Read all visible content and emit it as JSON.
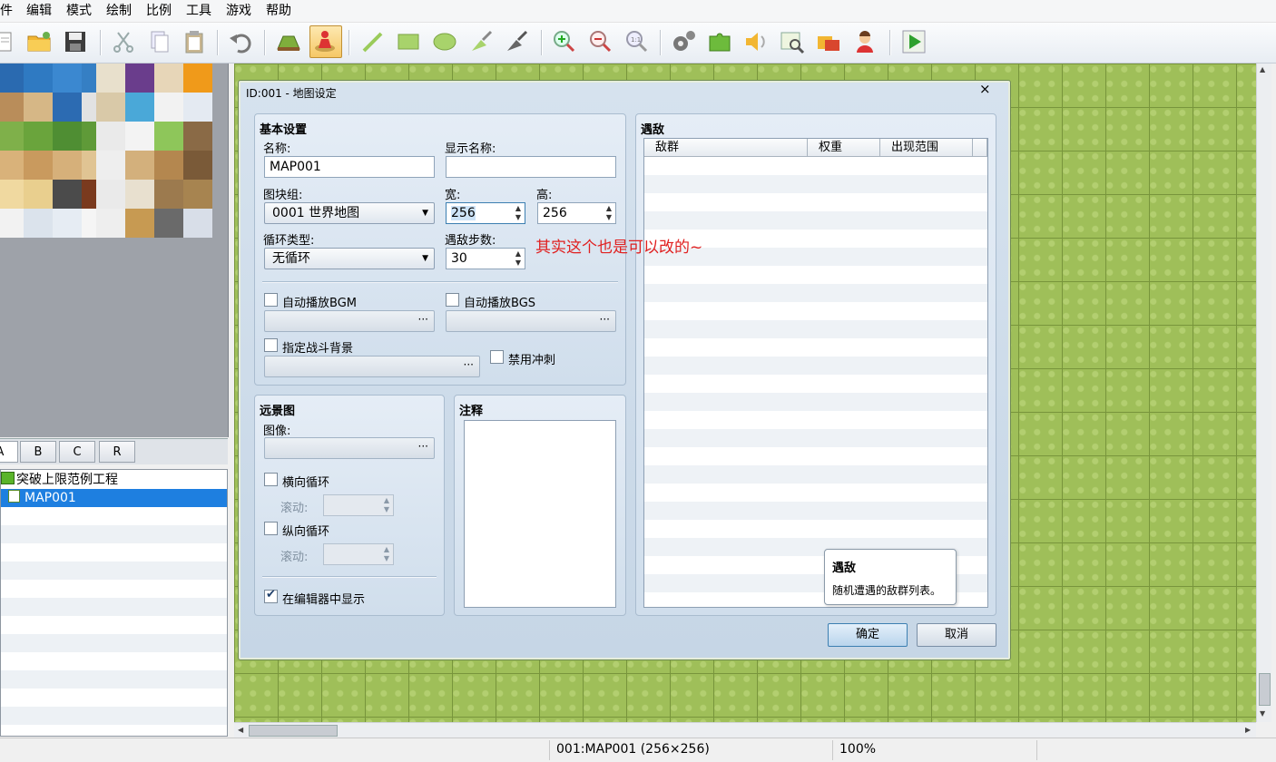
{
  "menu": [
    "件",
    "编辑",
    "模式",
    "绘制",
    "比例",
    "工具",
    "游戏",
    "帮助"
  ],
  "tileset_tabs": [
    "A",
    "B",
    "C",
    "R"
  ],
  "tree": {
    "project": "突破上限范例工程",
    "map": "MAP001"
  },
  "status": {
    "map": "001:MAP001 (256×256)",
    "zoom": "100%"
  },
  "dialog": {
    "title": "ID:001 - 地图设定",
    "close": "×",
    "basic": {
      "title": "基本设置",
      "name_label": "名称:",
      "name_value": "MAP001",
      "display_label": "显示名称:",
      "display_value": "",
      "tileset_label": "图块组:",
      "tileset_value": "0001 世界地图",
      "width_label": "宽:",
      "width_value": "256",
      "height_label": "高:",
      "height_value": "256",
      "loop_label": "循环类型:",
      "loop_value": "无循环",
      "steps_label": "遇敌步数:",
      "steps_value": "30",
      "bgm_label": "自动播放BGM",
      "bgs_label": "自动播放BGS",
      "battleback_label": "指定战斗背景",
      "dash_label": "禁用冲刺",
      "browse": "···"
    },
    "parallax": {
      "title": "远景图",
      "image_label": "图像:",
      "hloop_label": "横向循环",
      "vloop_label": "纵向循环",
      "scroll_label": "滚动:",
      "show_label": "在编辑器中显示",
      "browse": "···"
    },
    "note": {
      "title": "注释"
    },
    "encounters": {
      "title": "遇敌",
      "columns": [
        "敌群",
        "权重",
        "出现范围"
      ]
    },
    "tooltip": {
      "title": "遇敌",
      "text": "随机遭遇的敌群列表。"
    },
    "ok": "确定",
    "cancel": "取消"
  },
  "annotation": "其实这个也是可以改的~",
  "icons": [
    "new-icon",
    "open-icon",
    "save-icon",
    "cut-icon",
    "copy-icon",
    "paste-icon",
    "undo-icon",
    "map-mode-icon",
    "event-mode-icon",
    "pencil-icon",
    "rectangle-icon",
    "ellipse-icon",
    "fill-icon",
    "shadow-pen-icon",
    "zoom-in-icon",
    "zoom-out-icon",
    "zoom-actual-icon",
    "database-icon",
    "plugin-icon",
    "sound-icon",
    "event-search-icon",
    "resource-icon",
    "character-generator-icon",
    "playtest-icon"
  ]
}
